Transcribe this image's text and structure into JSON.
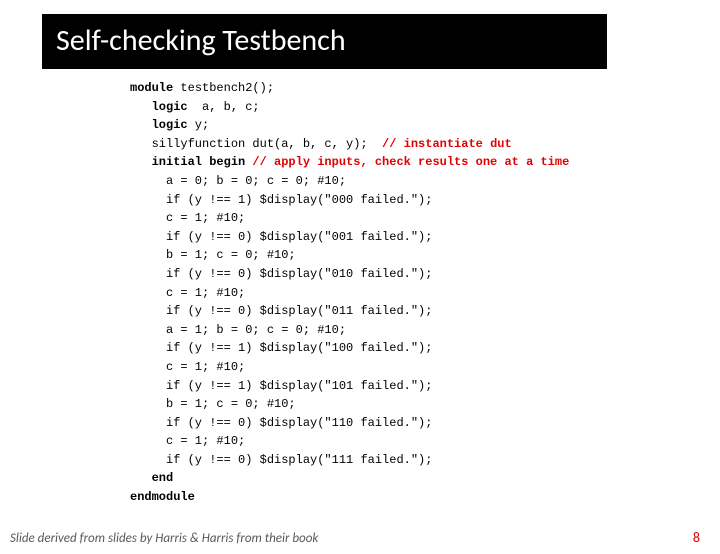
{
  "title": "Self-checking Testbench",
  "code": {
    "l1a": "module",
    "l1b": " testbench2();",
    "l2a": "   logic",
    "l2b": "  a, b, c;",
    "l3a": "   logic",
    "l3b": " y;",
    "l4a": "   sillyfunction dut(a, b, c, y);  ",
    "l4b": "// instantiate dut",
    "l5a": "   initial begin ",
    "l5b": "// apply inputs, check results one at a time",
    "l6": "     a = 0; b = 0; c = 0; #10;",
    "l7": "     if (y !== 1) $display(\"000 failed.\");",
    "l8": "     c = 1; #10;",
    "l9": "     if (y !== 0) $display(\"001 failed.\");",
    "l10": "     b = 1; c = 0; #10;",
    "l11": "     if (y !== 0) $display(\"010 failed.\");",
    "l12": "     c = 1; #10;",
    "l13": "     if (y !== 0) $display(\"011 failed.\");",
    "l14": "     a = 1; b = 0; c = 0; #10;",
    "l15": "     if (y !== 1) $display(\"100 failed.\");",
    "l16": "     c = 1; #10;",
    "l17": "     if (y !== 1) $display(\"101 failed.\");",
    "l18": "     b = 1; c = 0; #10;",
    "l19": "     if (y !== 0) $display(\"110 failed.\");",
    "l20": "     c = 1; #10;",
    "l21": "     if (y !== 0) $display(\"111 failed.\");",
    "l22a": "   end",
    "l23a": "endmodule"
  },
  "footer": "Slide derived from slides by Harris & Harris from their book",
  "page": "8"
}
